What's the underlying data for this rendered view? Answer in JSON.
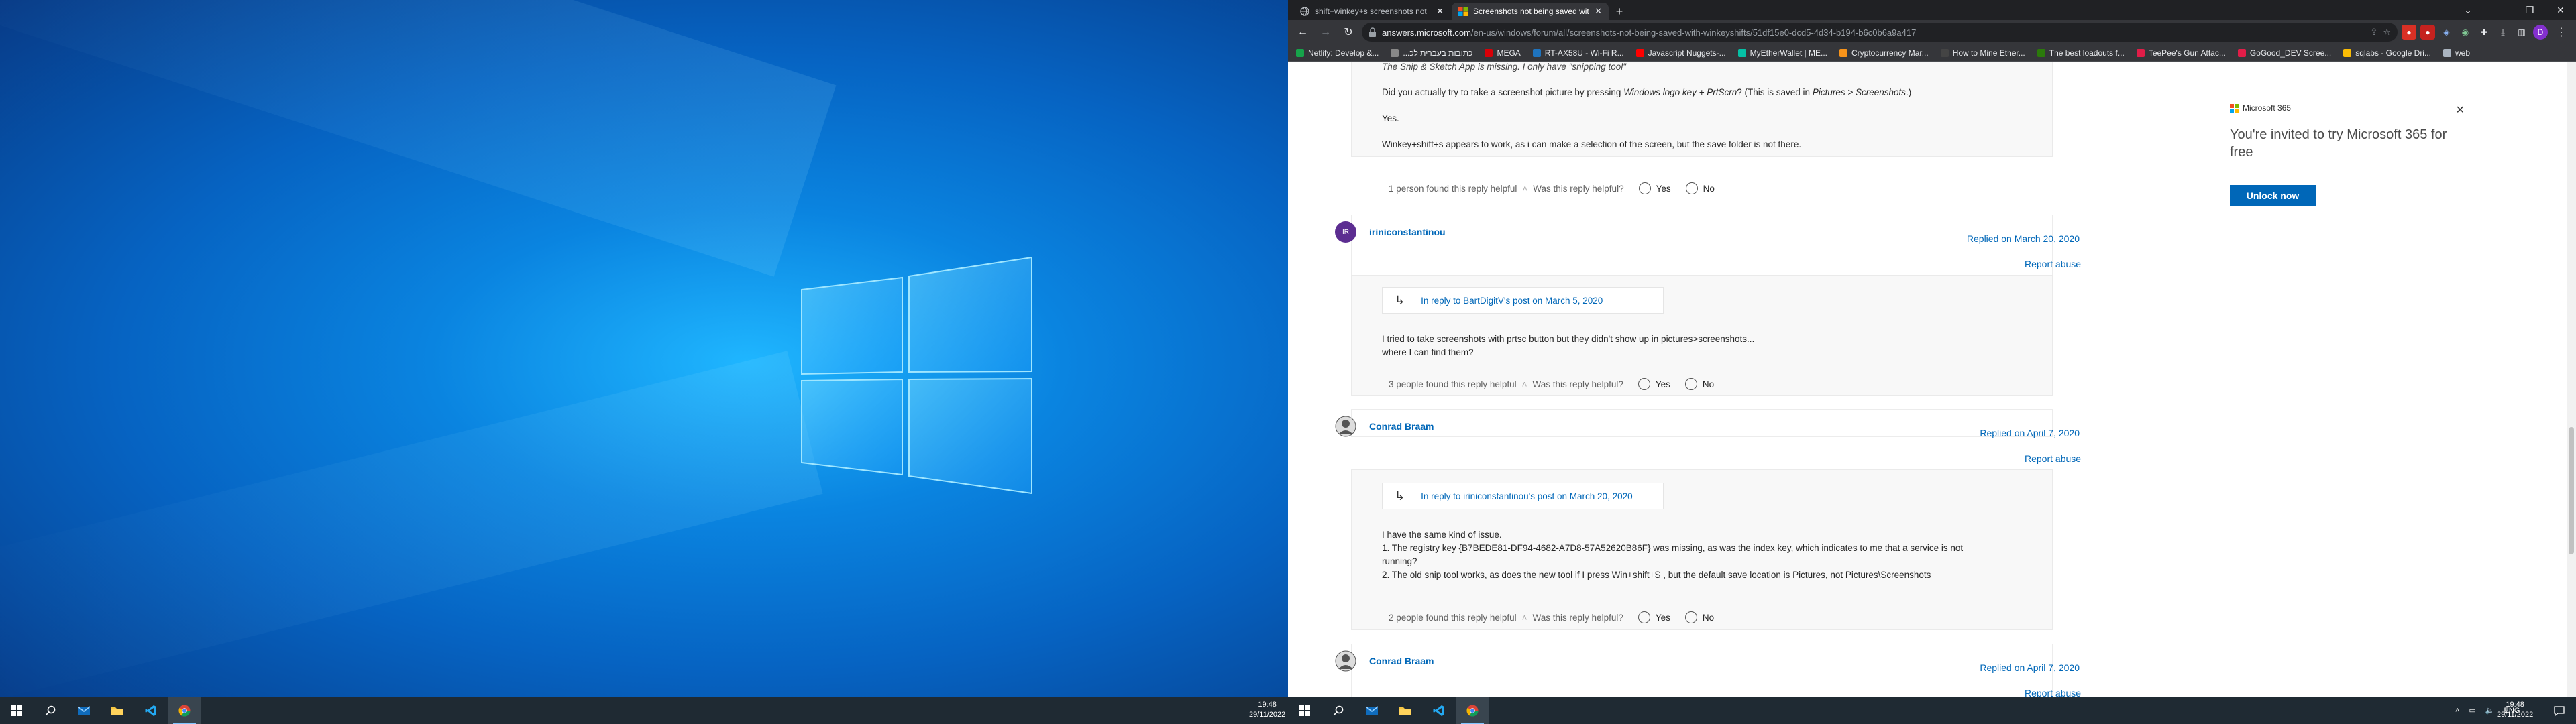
{
  "taskbar": {
    "time": "19:48",
    "date": "29/11/2022",
    "lang": "ENG"
  },
  "browser": {
    "tabs": [
      {
        "title": "shift+winkey+s screenshots not"
      },
      {
        "title": "Screenshots not being saved wit"
      }
    ],
    "url_host": "answers.microsoft.com",
    "url_path": "/en-us/windows/forum/all/screenshots-not-being-saved-with-winkeyshifts/51df15e0-dcd5-4d34-b194-b6c0b6a9a417",
    "avatar_letter": "D",
    "bookmarks": [
      {
        "label": "Netlify: Develop &...",
        "color": "#16a34a"
      },
      {
        "label": "...כתובות בעברית לכ",
        "color": "#888888"
      },
      {
        "label": "MEGA",
        "color": "#d90007"
      },
      {
        "label": "RT-AX58U - Wi-Fi R...",
        "color": "#1e73be"
      },
      {
        "label": "Javascript Nuggets-...",
        "color": "#ff0000"
      },
      {
        "label": "MyEtherWallet | ME...",
        "color": "#05c0a5"
      },
      {
        "label": "Cryptocurrency Mar...",
        "color": "#f7931a"
      },
      {
        "label": "How to Mine Ether...",
        "color": "#444444"
      },
      {
        "label": "The best loadouts f...",
        "color": "#2b7a0b"
      },
      {
        "label": "TeePee's Gun Attac...",
        "color": "#e11d48"
      },
      {
        "label": "GoGood_DEV Scree...",
        "color": "#e11d48"
      },
      {
        "label": "sqlabs - Google Dri...",
        "color": "#fbbc04"
      },
      {
        "label": "web",
        "color": "#aab4c0"
      }
    ]
  },
  "thread": {
    "quote_text": "The Snip & Sketch App is missing. I only have \"snipping tool\"",
    "q2_pre": "Did you actually try to take a screenshot picture by pressing ",
    "q2_em1": "Windows logo key + PrtScrn",
    "q2_mid": "? (This is saved in ",
    "q2_em2": "Pictures > Screenshots",
    "q2_end": ".)",
    "yes_answer": "Yes.",
    "p1_text": "Winkey+shift+s appears to work, as i can make a selection of the screen, but the save folder is not there.",
    "p1_helpful": "1 person found this reply helpful",
    "helpful_q": "Was this reply helpful?",
    "yes": "Yes",
    "no": "No",
    "posts": [
      {
        "author": "iriniconstantinou",
        "avatar_initials": "IR",
        "replied": "Replied on March 20, 2020",
        "report": "Report abuse",
        "inreply": "In reply to BartDigitV's post on March 5, 2020",
        "body1": "I tried to take screenshots with prtsc button but they didn't show up in pictures>screenshots...",
        "body2": "where I can find them?",
        "helpful": "3 people found this reply helpful"
      },
      {
        "author": "Conrad Braam",
        "replied": "Replied on April 7, 2020",
        "report": "Report abuse",
        "inreply": "In reply to iriniconstantinou's post on March 20, 2020",
        "body1": "I have the same kind of issue.",
        "body2": "1. The registry key {B7BEDE81-DF94-4682-A7D8-57A52620B86F} was missing, as was the index key, which indicates to me that a service is not",
        "body3": "running?",
        "body4": "2. The old snip tool works, as does the new tool if I press Win+shift+S , but the default save location is Pictures, not Pictures\\Screenshots",
        "helpful": "2 people found this reply helpful"
      },
      {
        "author": "Conrad Braam",
        "replied": "Replied on April 7, 2020",
        "report": "Report abuse"
      }
    ]
  },
  "ad": {
    "brand": "Microsoft 365",
    "headline": "You're invited to try Microsoft 365 for free",
    "cta": "Unlock now"
  }
}
